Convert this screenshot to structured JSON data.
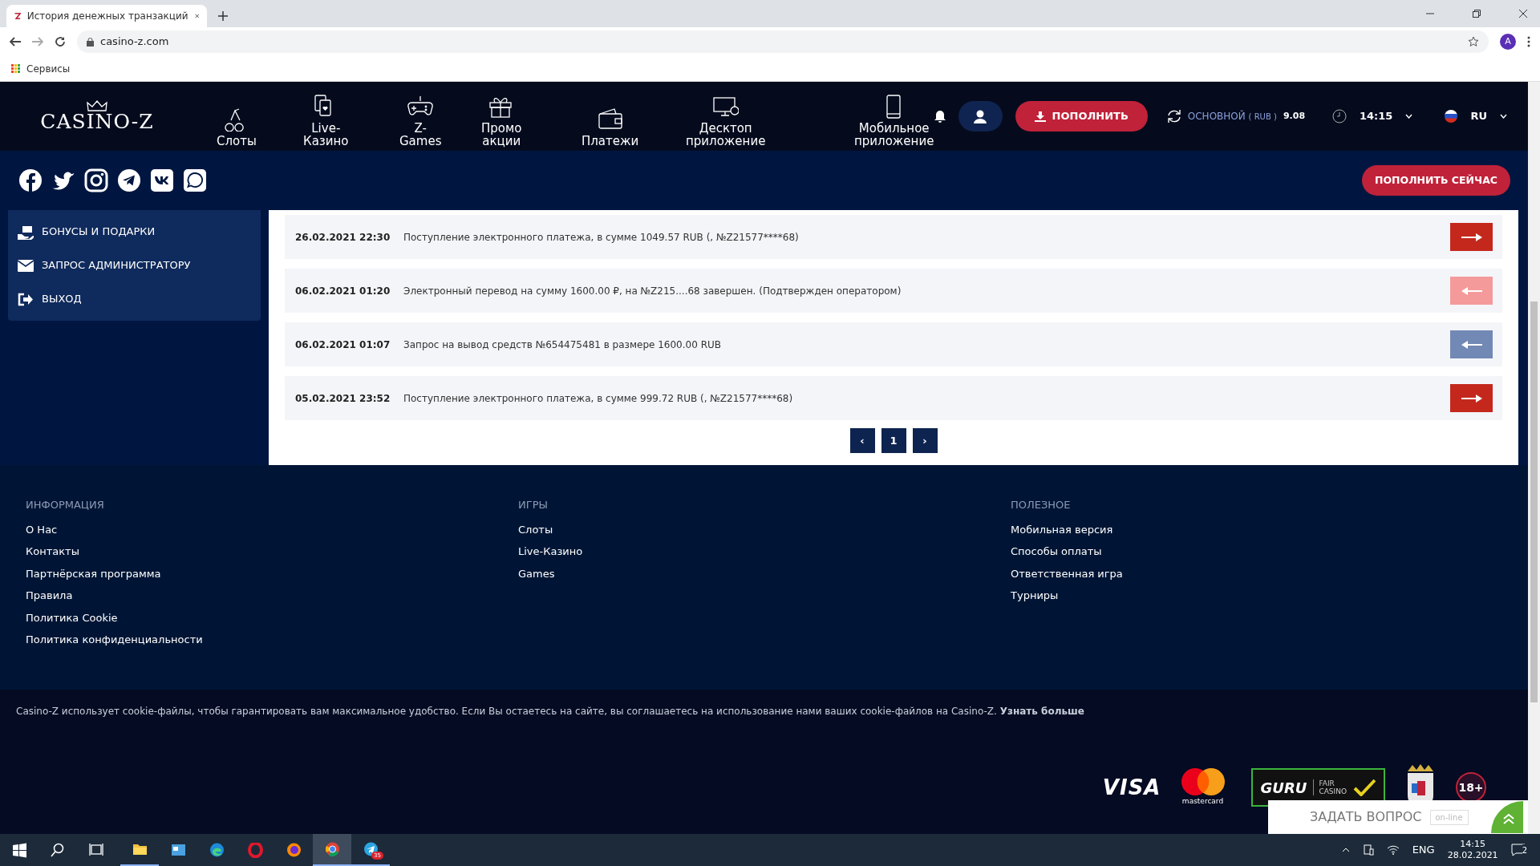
{
  "browser": {
    "tab_title": "История денежных транзакций",
    "url": "casino-z.com",
    "bookmark": "Сервисы",
    "profile": "A"
  },
  "header": {
    "logo": "CASINO-Z",
    "nav": [
      {
        "label": "Слоты"
      },
      {
        "label": "Live-\nКазино"
      },
      {
        "label": "Z-\nGames"
      },
      {
        "label": "Промо\nакции"
      },
      {
        "label": "Платежи"
      },
      {
        "label": "Десктоп\nприложение"
      },
      {
        "label": "Мобильное\nприложение"
      }
    ],
    "deposit_button": "ПОПОЛНИТЬ",
    "balance": {
      "label": "ОСНОВНОЙ",
      "currency": "( RUB )",
      "amount": "9.08"
    },
    "time": "14:15",
    "language": "RU"
  },
  "social_bar": {
    "deposit_now_button": "ПОПОЛНИТЬ СЕЙЧАС"
  },
  "sidebar": {
    "items": [
      {
        "label": "БОНУСЫ И ПОДАРКИ"
      },
      {
        "label": "ЗАПРОС АДМИНИСТРАТОРУ"
      },
      {
        "label": "ВЫХОД"
      }
    ]
  },
  "transactions": [
    {
      "date": "26.02.2021 22:30",
      "description": "Поступление электронного платежа, в сумме 1049.57 RUB (, №Z21577****68)",
      "kind": "deposit"
    },
    {
      "date": "06.02.2021 01:20",
      "description": "Электронный перевод на сумму 1600.00 ₽, на №Z215....68 завершен. (Подтвержден оператором)",
      "kind": "payout"
    },
    {
      "date": "06.02.2021 01:07",
      "description": "Запрос на вывод средств №654475481 в размере 1600.00 RUB",
      "kind": "request"
    },
    {
      "date": "05.02.2021 23:52",
      "description": "Поступление электронного платежа, в сумме 999.72 RUB (, №Z21577****68)",
      "kind": "deposit"
    }
  ],
  "pagination": {
    "prev": "‹",
    "pages": [
      "1"
    ],
    "next": "›"
  },
  "footer": {
    "columns": [
      {
        "heading": "ИНФОРМАЦИЯ",
        "links": [
          "О Нас",
          "Контакты",
          "Партнёрская программа",
          "Правила",
          "Политика Cookie",
          "Политика конфиденциальности"
        ]
      },
      {
        "heading": "ИГРЫ",
        "links": [
          "Слоты",
          "Live-Казино",
          "Games"
        ]
      },
      {
        "heading": "ПОЛЕЗНОЕ",
        "links": [
          "Мобильная версия",
          "Способы оплаты",
          "Ответственная игра",
          "Турниры"
        ]
      }
    ]
  },
  "cookie_notice": {
    "text": "Casino-Z использует cookie-файлы, чтобы гарантировать вам максимальное удобство. Если Вы остаетесь на сайте, вы соглашаетесь на использование нами ваших cookie-файлов на Casino-Z.",
    "link": "Узнать больше"
  },
  "badges": {
    "visa": "VISA",
    "mastercard": "mastercard",
    "guru": "GURU",
    "fair": "FAIR\nCASINO",
    "age": "18+"
  },
  "chat_widget": {
    "label": "ЗАДАТЬ ВОПРОС",
    "status": "on-line"
  },
  "taskbar": {
    "telegram_badge": "35",
    "language": "ENG",
    "time": "14:15",
    "date": "28.02.2021",
    "notifications": "2"
  }
}
